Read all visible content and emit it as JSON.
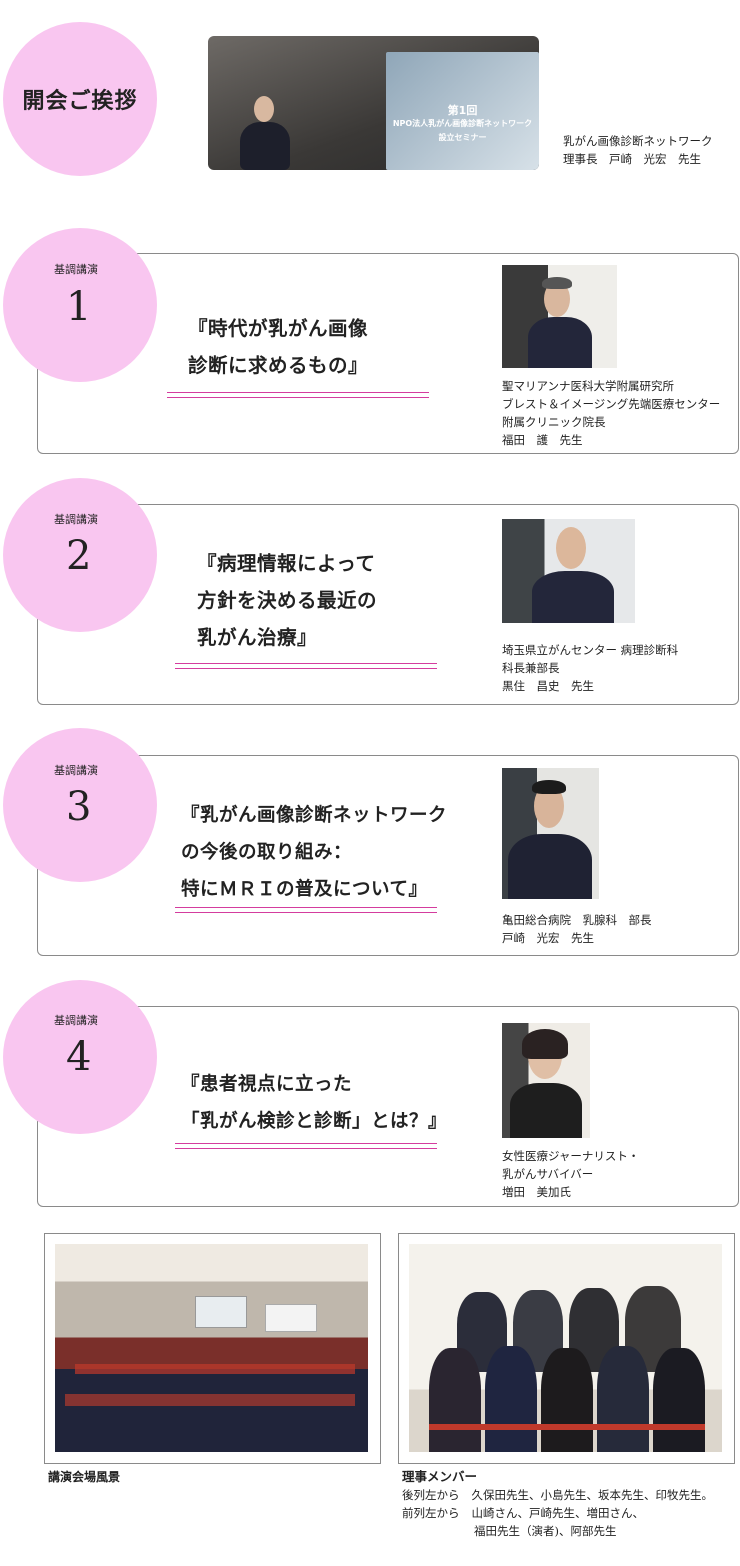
{
  "opening": {
    "title": "開会ご挨拶",
    "caption_line1": "乳がん画像診断ネットワーク",
    "caption_line2": "理事長　戸崎　光宏　先生",
    "slide_line1": "第1回",
    "slide_line2": "NPO法人乳がん画像診断ネットワーク",
    "slide_line3": "設立セミナー"
  },
  "talks": [
    {
      "label": "基調講演",
      "number": "1",
      "title_lines": [
        "『時代が乳がん画像",
        "診断に求めるもの』"
      ],
      "speaker_lines": [
        "聖マリアンナ医科大学附属研究所",
        "ブレスト＆イメージング先端医療センター",
        "附属クリニック院長",
        "福田　護　先生"
      ]
    },
    {
      "label": "基調講演",
      "number": "2",
      "title_lines": [
        "『病理情報によって",
        "方針を決める最近の",
        "乳がん治療』"
      ],
      "speaker_lines": [
        "埼玉県立がんセンター 病理診断科",
        "科長兼部長",
        "黒住　昌史　先生"
      ]
    },
    {
      "label": "基調講演",
      "number": "3",
      "title_lines": [
        "『乳がん画像診断ネットワーク",
        "の今後の取り組み：",
        "特にＭＲＩの普及について』"
      ],
      "speaker_lines": [
        "亀田総合病院　乳腺科　部長",
        "戸崎　光宏　先生"
      ]
    },
    {
      "label": "基調講演",
      "number": "4",
      "title_lines": [
        "『患者視点に立った",
        "「乳がん検診と診断」とは？』"
      ],
      "speaker_lines": [
        "女性医療ジャーナリスト・",
        "乳がんサバイバー",
        "増田　美加氏"
      ]
    }
  ],
  "venue": {
    "caption": "講演会場風景"
  },
  "members": {
    "caption": "理事メンバー",
    "back_label": "後列左から",
    "back_names": "久保田先生、小島先生、坂本先生、印牧先生。",
    "front_label": "前列左から",
    "front_names1": "山崎さん、戸崎先生、増田さん、",
    "front_names2": "福田先生（演者)、阿部先生"
  },
  "colors": {
    "circle_pink": "#f9c6f0",
    "underline_magenta": "#d43c9e",
    "card_border": "#8a8a8a"
  }
}
